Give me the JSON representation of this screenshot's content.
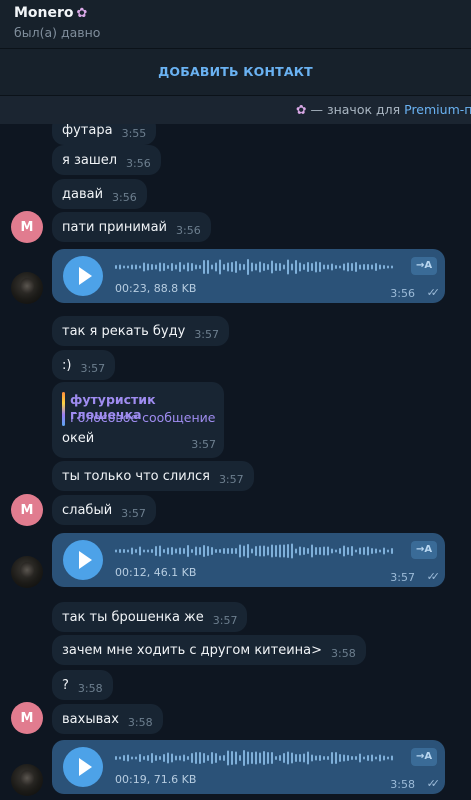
{
  "header": {
    "name": "Monero",
    "status": "был(а) давно"
  },
  "add_contact": {
    "label": "ДОБАВИТЬ КОНТАКТ"
  },
  "premium": {
    "text": "— значок для ",
    "link": "Premium-по"
  },
  "avatars": {
    "initial": "M"
  },
  "messages": [
    {
      "text": "футара",
      "time": "3:55"
    },
    {
      "text": "я зашел",
      "time": "3:56"
    },
    {
      "text": "давай",
      "time": "3:56"
    },
    {
      "text": "пати принимай",
      "time": "3:56"
    },
    {
      "text": "так я рекать буду",
      "time": "3:57"
    },
    {
      "text": ":)",
      "time": "3:57"
    },
    {
      "text": "ты только что слился",
      "time": "3:57"
    },
    {
      "text": "слабый",
      "time": "3:57"
    },
    {
      "text": "так ты брошенка же",
      "time": "3:57"
    },
    {
      "text": "зачем мне ходить с другом китеина>",
      "time": "3:58"
    },
    {
      "text": "?",
      "time": "3:58"
    },
    {
      "text": "вахывах",
      "time": "3:58"
    }
  ],
  "reply_message": {
    "author": "футуристик глошечка",
    "subtitle": "Голосовое сообщение",
    "text": "окей",
    "time": "3:57"
  },
  "voice_messages": [
    {
      "meta": "00:23, 88.8 KB",
      "time": "3:56",
      "progress": 0
    },
    {
      "meta": "00:12, 46.1 KB",
      "time": "3:57",
      "progress": 0
    },
    {
      "meta": "00:19, 71.6 KB",
      "time": "3:58",
      "progress": 0
    }
  ],
  "transcribe_label": "→A",
  "read_mark": "✓✓",
  "icons": {
    "play": "play-icon",
    "transcribe": "transcribe-icon",
    "read": "double-check-icon",
    "premium": "unicorn-emoji-icon"
  },
  "colors": {
    "background": "#0e1621",
    "incoming_bubble": "#182533",
    "voice_bubble": "#2b5278",
    "accent": "#6ab2f2",
    "avatar": "#e17c8f",
    "play": "#4da2e8"
  }
}
